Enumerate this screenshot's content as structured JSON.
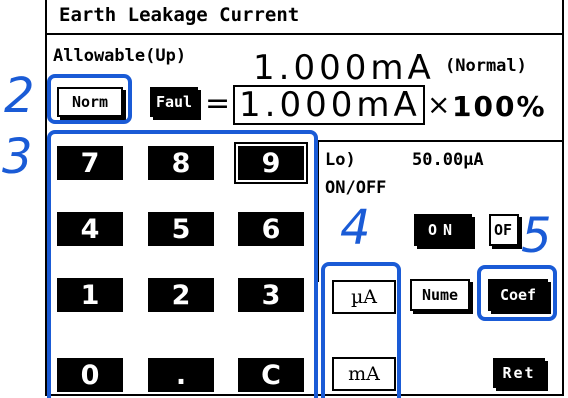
{
  "title": "Earth Leakage Current",
  "allowable_label": "Allowable(Up)",
  "allowable_value": "1.000mA",
  "mode_label": "(Normal)",
  "norm_button": "Norm",
  "faul_button": "Faul",
  "equals": "=",
  "coef_value": "1.000mA",
  "multiply": "×",
  "percent_value": "100%",
  "lo_label": "Lo)",
  "lo_value": "50.00µA",
  "on_off_label": "ON/OFF",
  "on_button": "ON",
  "off_button": "OF",
  "keypad": [
    "7",
    "8",
    "9",
    "4",
    "5",
    "6",
    "1",
    "2",
    "3",
    "0",
    ".",
    "C"
  ],
  "unit_ua": "µA",
  "unit_ma": "mA",
  "nume_button": "Nume",
  "coef_button": "Coef",
  "ret_button": "Ret",
  "callouts": [
    "2",
    "3",
    "4",
    "5"
  ],
  "colors": {
    "callout": "#1a5bd6",
    "key_bg": "#000000",
    "screen_bg": "#ffffff"
  }
}
